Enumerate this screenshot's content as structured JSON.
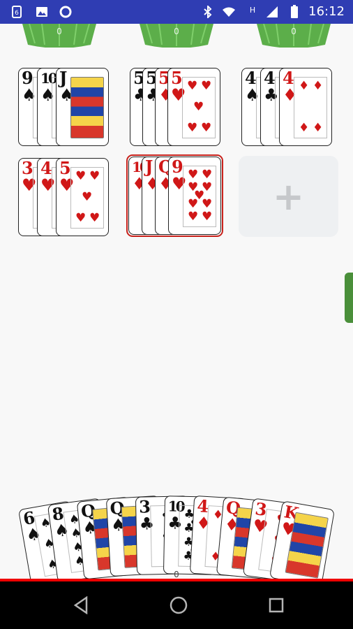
{
  "status_bar": {
    "time": "16:12",
    "network_indicator": "H"
  },
  "opponents": [
    {
      "count": "0"
    },
    {
      "count": "0"
    },
    {
      "count": "0"
    }
  ],
  "melds": [
    {
      "cards": [
        {
          "rank": "9",
          "suit": "♠",
          "color": "black"
        },
        {
          "rank": "10",
          "suit": "♠",
          "color": "black"
        },
        {
          "rank": "J",
          "suit": "♠",
          "color": "black",
          "face": true
        }
      ]
    },
    {
      "cards": [
        {
          "rank": "5",
          "suit": "♣",
          "color": "black"
        },
        {
          "rank": "5",
          "suit": "♣",
          "color": "black"
        },
        {
          "rank": "5",
          "suit": "♦",
          "color": "red"
        },
        {
          "rank": "5",
          "suit": "♥",
          "color": "red"
        }
      ]
    },
    {
      "cards": [
        {
          "rank": "4",
          "suit": "♠",
          "color": "black"
        },
        {
          "rank": "4",
          "suit": "♣",
          "color": "black"
        },
        {
          "rank": "4",
          "suit": "♦",
          "color": "red"
        }
      ]
    },
    {
      "cards": [
        {
          "rank": "3",
          "suit": "♥",
          "color": "red"
        },
        {
          "rank": "4",
          "suit": "♥",
          "color": "red"
        },
        {
          "rank": "5",
          "suit": "♥",
          "color": "red"
        }
      ]
    },
    {
      "cards": [
        {
          "rank": "10",
          "suit": "♦",
          "color": "red"
        },
        {
          "rank": "J",
          "suit": "♦",
          "color": "red"
        },
        {
          "rank": "Q",
          "suit": "♦",
          "color": "red"
        },
        {
          "rank": "9",
          "suit": "♥",
          "color": "red"
        }
      ],
      "selected": true
    }
  ],
  "add_slot": {
    "label": "+"
  },
  "hand": {
    "count": "0",
    "cards": [
      {
        "rank": "6",
        "suit": "♠",
        "color": "black"
      },
      {
        "rank": "8",
        "suit": "♠",
        "color": "black"
      },
      {
        "rank": "Q",
        "suit": "♠",
        "color": "black",
        "face": true
      },
      {
        "rank": "Q",
        "suit": "♠",
        "color": "black",
        "face": true
      },
      {
        "rank": "3",
        "suit": "♣",
        "color": "black"
      },
      {
        "rank": "10",
        "suit": "♣",
        "color": "black"
      },
      {
        "rank": "4",
        "suit": "♦",
        "color": "red"
      },
      {
        "rank": "Q",
        "suit": "♦",
        "color": "red",
        "face": true
      },
      {
        "rank": "3",
        "suit": "♥",
        "color": "red"
      },
      {
        "rank": "K",
        "suit": "♥",
        "color": "red",
        "face": true
      }
    ]
  },
  "colors": {
    "status_bar": "#2f3db3",
    "card_back_green": "#5cae4a",
    "selected_border": "#c8211b",
    "bottom_line": "#ee0000"
  },
  "nav": {
    "back_icon": "back-triangle-icon",
    "home_icon": "home-circle-icon",
    "recents_icon": "recents-square-icon"
  }
}
